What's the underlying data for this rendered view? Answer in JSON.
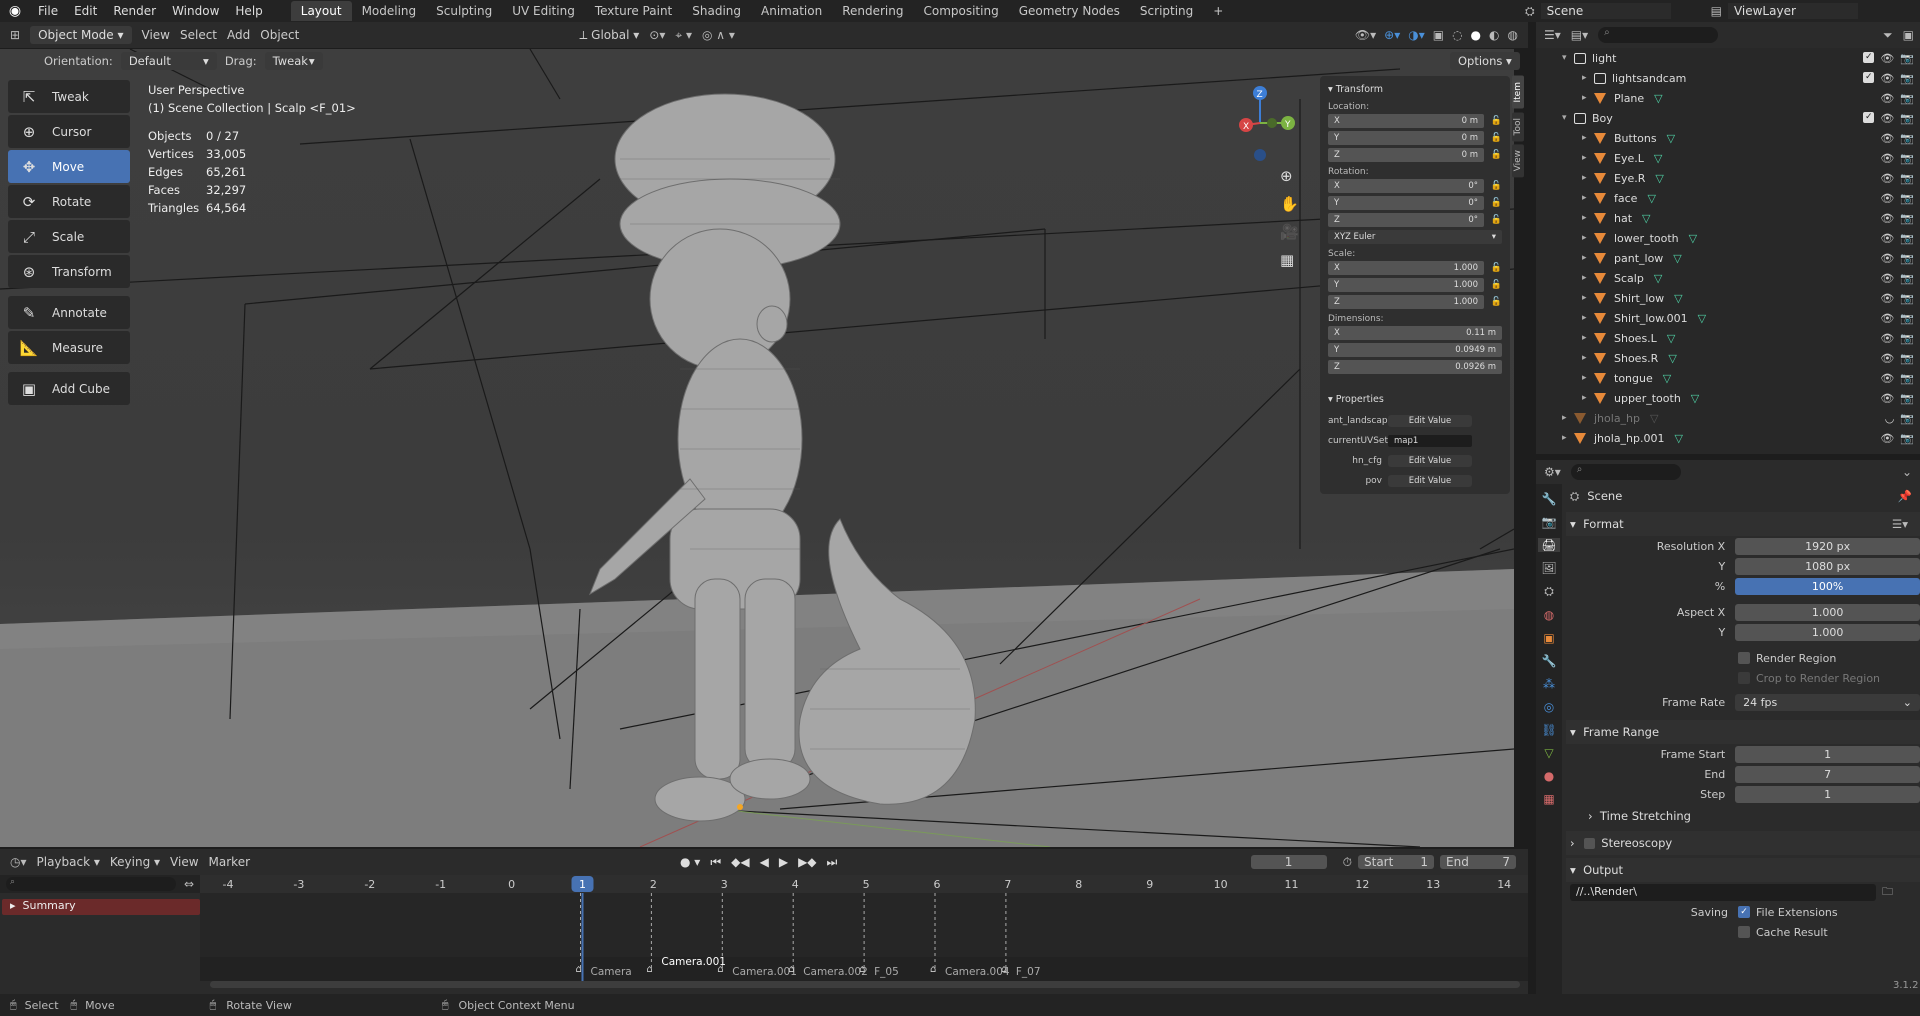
{
  "topbar": {
    "menus": [
      "File",
      "Edit",
      "Render",
      "Window",
      "Help"
    ],
    "workspaces": [
      "Layout",
      "Modeling",
      "Sculpting",
      "UV Editing",
      "Texture Paint",
      "Shading",
      "Animation",
      "Rendering",
      "Compositing",
      "Geometry Nodes",
      "Scripting"
    ],
    "active_workspace": "Layout",
    "scene": "Scene",
    "view_layer": "ViewLayer"
  },
  "viewport_header": {
    "mode": "Object Mode",
    "menus": [
      "View",
      "Select",
      "Add",
      "Object"
    ],
    "transform_orientation": "Global",
    "orientation_label": "Orientation:",
    "orientation_value": "Default",
    "drag_label": "Drag:",
    "drag_value": "Tweak",
    "options": "Options"
  },
  "viewport": {
    "perspective": "User Perspective",
    "collection": "(1) Scene Collection | Scalp <F_01>",
    "stats": [
      {
        "label": "Objects",
        "value": "0 / 27"
      },
      {
        "label": "Vertices",
        "value": "33,005"
      },
      {
        "label": "Edges",
        "value": "65,261"
      },
      {
        "label": "Faces",
        "value": "32,297"
      },
      {
        "label": "Triangles",
        "value": "64,564"
      }
    ]
  },
  "tools": [
    {
      "label": "Tweak",
      "icon": "tweak-icon",
      "active": false
    },
    {
      "label": "Cursor",
      "icon": "cursor-icon",
      "active": false
    },
    {
      "label": "Move",
      "icon": "move-icon",
      "active": true
    },
    {
      "label": "Rotate",
      "icon": "rotate-icon",
      "active": false
    },
    {
      "label": "Scale",
      "icon": "scale-icon",
      "active": false
    },
    {
      "label": "Transform",
      "icon": "transform-icon",
      "active": false
    },
    {
      "label": "Annotate",
      "icon": "annotate-icon",
      "active": false
    },
    {
      "label": "Measure",
      "icon": "measure-icon",
      "active": false
    },
    {
      "label": "Add Cube",
      "icon": "add-cube-icon",
      "active": false
    }
  ],
  "npanel": {
    "tabs": [
      "Item",
      "Tool",
      "View"
    ],
    "transform_title": "Transform",
    "location_label": "Location:",
    "location": [
      {
        "axis": "X",
        "value": "0 m"
      },
      {
        "axis": "Y",
        "value": "0 m"
      },
      {
        "axis": "Z",
        "value": "0 m"
      }
    ],
    "rotation_label": "Rotation:",
    "rotation": [
      {
        "axis": "X",
        "value": "0°"
      },
      {
        "axis": "Y",
        "value": "0°"
      },
      {
        "axis": "Z",
        "value": "0°"
      }
    ],
    "rotation_mode": "XYZ Euler",
    "scale_label": "Scale:",
    "scale": [
      {
        "axis": "X",
        "value": "1.000"
      },
      {
        "axis": "Y",
        "value": "1.000"
      },
      {
        "axis": "Z",
        "value": "1.000"
      }
    ],
    "dimensions_label": "Dimensions:",
    "dimensions": [
      {
        "axis": "X",
        "value": "0.11 m"
      },
      {
        "axis": "Y",
        "value": "0.0949 m"
      },
      {
        "axis": "Z",
        "value": "0.0926 m"
      }
    ],
    "properties_title": "Properties",
    "properties": [
      {
        "name": "ant_landscape",
        "value": "Edit Value"
      },
      {
        "name": "currentUVSet",
        "value": "map1"
      },
      {
        "name": "hn_cfg",
        "value": "Edit Value"
      },
      {
        "name": "pov",
        "value": "Edit Value"
      }
    ]
  },
  "outliner": {
    "items": [
      {
        "name": "light",
        "depth": 0,
        "type": "collection",
        "expanded": true
      },
      {
        "name": "lightsandcam",
        "depth": 1,
        "type": "collection"
      },
      {
        "name": "Plane",
        "depth": 1,
        "type": "object"
      },
      {
        "name": "Boy",
        "depth": 0,
        "type": "collection",
        "expanded": true
      },
      {
        "name": "Buttons",
        "depth": 1,
        "type": "object"
      },
      {
        "name": "Eye.L",
        "depth": 1,
        "type": "object"
      },
      {
        "name": "Eye.R",
        "depth": 1,
        "type": "object"
      },
      {
        "name": "face",
        "depth": 1,
        "type": "object"
      },
      {
        "name": "hat",
        "depth": 1,
        "type": "object"
      },
      {
        "name": "lower_tooth",
        "depth": 1,
        "type": "object"
      },
      {
        "name": "pant_low",
        "depth": 1,
        "type": "object"
      },
      {
        "name": "Scalp",
        "depth": 1,
        "type": "object"
      },
      {
        "name": "Shirt_low",
        "depth": 1,
        "type": "object"
      },
      {
        "name": "Shirt_low.001",
        "depth": 1,
        "type": "object"
      },
      {
        "name": "Shoes.L",
        "depth": 1,
        "type": "object"
      },
      {
        "name": "Shoes.R",
        "depth": 1,
        "type": "object"
      },
      {
        "name": "tongue",
        "depth": 1,
        "type": "object"
      },
      {
        "name": "upper_tooth",
        "depth": 1,
        "type": "object"
      },
      {
        "name": "jhola_hp",
        "depth": 0,
        "type": "object",
        "dim": true
      },
      {
        "name": "jhola_hp.001",
        "depth": 0,
        "type": "object"
      }
    ]
  },
  "properties_editor": {
    "context": "Scene",
    "format_title": "Format",
    "resolution_x_label": "Resolution X",
    "resolution_x": "1920 px",
    "resolution_y_label": "Y",
    "resolution_y": "1080 px",
    "percent_label": "%",
    "percent": "100%",
    "aspect_x_label": "Aspect X",
    "aspect_x": "1.000",
    "aspect_y_label": "Y",
    "aspect_y": "1.000",
    "render_region": "Render Region",
    "crop_region": "Crop to Render Region",
    "frame_rate_label": "Frame Rate",
    "frame_rate": "24 fps",
    "frame_range_title": "Frame Range",
    "frame_start_label": "Frame Start",
    "frame_start": "1",
    "frame_end_label": "End",
    "frame_end": "7",
    "frame_step_label": "Step",
    "frame_step": "1",
    "time_stretching": "Time Stretching",
    "stereoscopy": "Stereoscopy",
    "output_title": "Output",
    "output_path": "//..\\Render\\",
    "saving_label": "Saving",
    "file_extensions": "File Extensions",
    "cache_result": "Cache Result"
  },
  "timeline": {
    "menus": [
      "Playback",
      "Keying",
      "View",
      "Marker"
    ],
    "current_frame": "1",
    "start_label": "Start",
    "start": "1",
    "end_label": "End",
    "end": "7",
    "ruler": [
      "-4",
      "-3",
      "-2",
      "-1",
      "0",
      "1",
      "2",
      "3",
      "4",
      "5",
      "6",
      "7",
      "8",
      "9",
      "10",
      "11",
      "12",
      "13",
      "14"
    ],
    "summary": "Summary",
    "markers": [
      {
        "label": "Camera",
        "frame": 0
      },
      {
        "label": "Camera.001",
        "frame": 1
      },
      {
        "label": "Camera.001",
        "frame": 2
      },
      {
        "label": "Camera.002",
        "frame": 3
      },
      {
        "label": "F_05",
        "frame": 4
      },
      {
        "label": "Camera.004",
        "frame": 5
      },
      {
        "label": "F_07",
        "frame": 6
      }
    ]
  },
  "statusbar": {
    "items": [
      "Select",
      "Move",
      "Rotate View",
      "Object Context Menu"
    ],
    "version": "3.1.2"
  }
}
